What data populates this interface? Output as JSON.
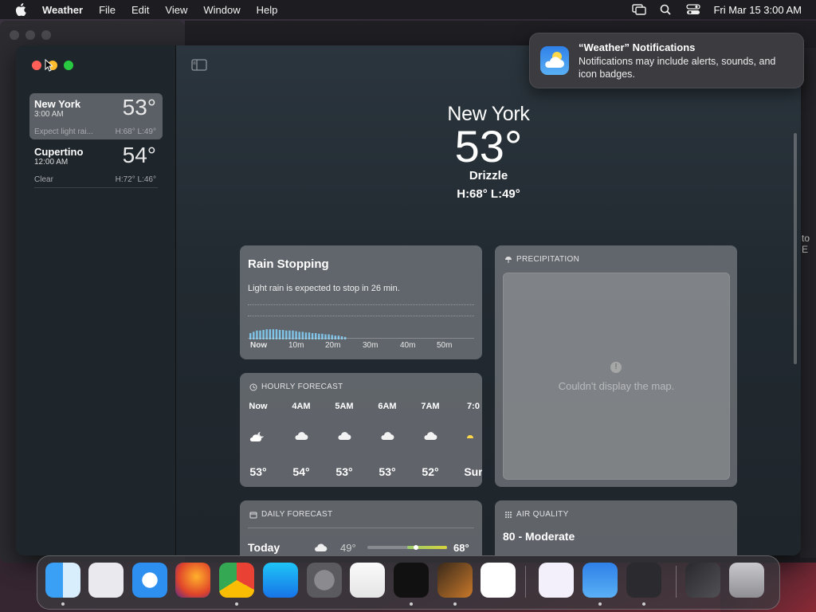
{
  "menubar": {
    "app_name": "Weather",
    "menus": [
      "File",
      "Edit",
      "View",
      "Window",
      "Help"
    ],
    "datetime": "Fri Mar 15  3:00 AM",
    "status_icons": [
      "screen-mirroring-icon",
      "search-icon",
      "control-center-icon"
    ]
  },
  "sidebar": {
    "locations": [
      {
        "name": "New York",
        "time": "3:00 AM",
        "temp": "53°",
        "condition": "Expect light rai...",
        "hilo": "H:68° L:49°",
        "selected": true
      },
      {
        "name": "Cupertino",
        "time": "12:00 AM",
        "temp": "54°",
        "condition": "Clear",
        "hilo": "H:72° L:46°",
        "selected": false
      }
    ]
  },
  "hero": {
    "city": "New York",
    "temp": "53°",
    "condition": "Drizzle",
    "hilo": "H:68°  L:49°"
  },
  "rain_card": {
    "title": "Rain Stopping",
    "description": "Light rain is expected to stop in 26 min.",
    "ticks": [
      "Now",
      "10m",
      "20m",
      "30m",
      "40m",
      "50m"
    ],
    "intensity": [
      0.5,
      0.6,
      0.7,
      0.7,
      0.75,
      0.8,
      0.8,
      0.8,
      0.8,
      0.75,
      0.75,
      0.7,
      0.7,
      0.7,
      0.65,
      0.6,
      0.6,
      0.55,
      0.55,
      0.5,
      0.5,
      0.45,
      0.45,
      0.4,
      0.4,
      0.35,
      0.3,
      0.3,
      0.25,
      0.2
    ]
  },
  "precipitation": {
    "header": "PRECIPITATION",
    "message": "Couldn't display the map."
  },
  "hourly": {
    "header": "HOURLY FORECAST",
    "hours": [
      {
        "time": "Now",
        "icon": "partly-cloudy-night-icon",
        "temp": "53°"
      },
      {
        "time": "4AM",
        "icon": "cloud-icon",
        "temp": "54°"
      },
      {
        "time": "5AM",
        "icon": "cloud-icon",
        "temp": "53°"
      },
      {
        "time": "6AM",
        "icon": "cloud-icon",
        "temp": "53°"
      },
      {
        "time": "7AM",
        "icon": "cloud-icon",
        "temp": "52°"
      },
      {
        "time": "7:0",
        "icon": "sunrise-icon",
        "temp": "Sur"
      }
    ]
  },
  "daily": {
    "header": "DAILY FORECAST",
    "rows": [
      {
        "day": "Today",
        "icon": "cloud-icon",
        "low": "49°",
        "high": "68°"
      }
    ]
  },
  "air_quality": {
    "header": "AIR QUALITY",
    "value": "80 - Moderate"
  },
  "notification": {
    "title": "“Weather” Notifications",
    "body": "Notifications may include alerts, sounds, and icon badges."
  },
  "dock": {
    "apps": [
      "Finder",
      "Launchpad",
      "Safari",
      "Firefox",
      "Chrome",
      "App Store",
      "System Settings",
      "TextEdit",
      "Terminal",
      "GarageBand",
      "Visual Studio Code",
      "Visual Studio",
      "Weather",
      "Unity Hub",
      "Preview",
      "Trash"
    ]
  },
  "background_window": {
    "fragment_text": "to E"
  },
  "colors": {
    "close": "#ff5f57",
    "minimize": "#febc2e",
    "zoom": "#28c840",
    "rain_bar": "#7fc4e8",
    "aq_gradient_start": "#9acd6b",
    "aq_gradient_end": "#d8d23c"
  }
}
